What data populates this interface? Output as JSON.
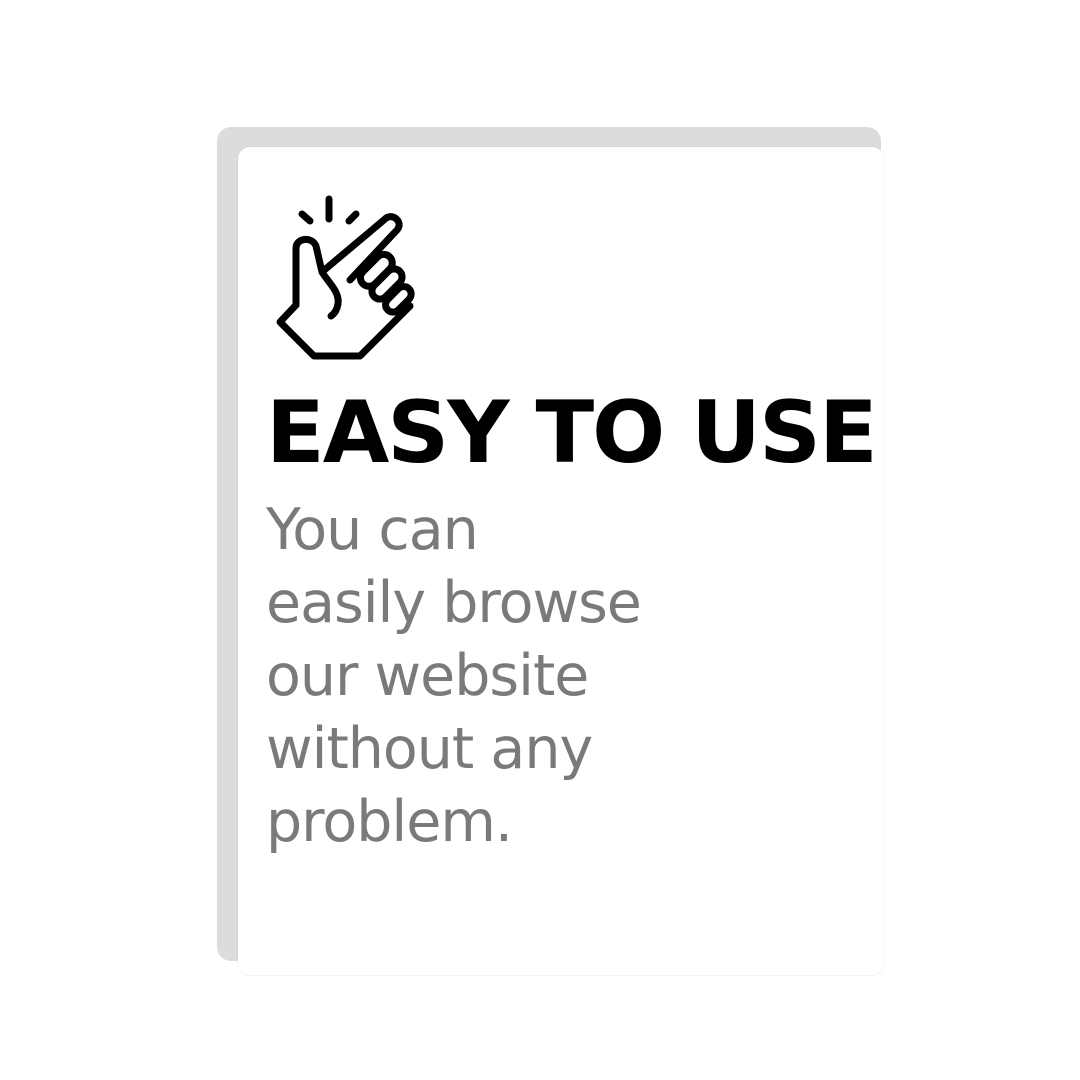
{
  "card": {
    "icon": "finger-snap-icon",
    "title": "EASY TO USE",
    "description_lines": [
      "You can",
      "easily browse",
      "our website",
      "without any",
      "problem."
    ]
  },
  "colors": {
    "title": "#000000",
    "description": "#7a7a7a",
    "card_back": "#dcdcdc",
    "card_front": "#ffffff"
  }
}
